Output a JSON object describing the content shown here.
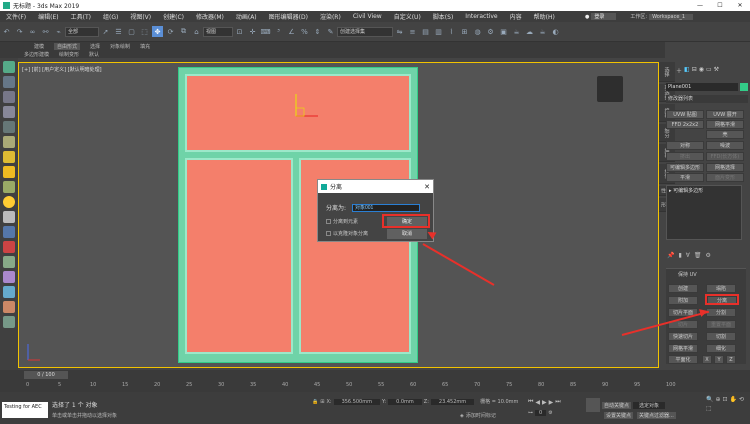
{
  "window": {
    "title": "无标题 - 3ds Max 2019",
    "user": "登录",
    "workspace_label": "工作区:",
    "workspace_value": "Workspace_1"
  },
  "menu": [
    "文件(F)",
    "编辑(E)",
    "工具(T)",
    "组(G)",
    "视图(V)",
    "创建(C)",
    "修改器(M)",
    "动画(A)",
    "图形编辑器(D)",
    "渲染(R)",
    "Civil View",
    "自定义(U)",
    "脚本(S)",
    "Interactive",
    "内容",
    "帮助(H)"
  ],
  "toolbar": {
    "filter": "全部",
    "view": "视图",
    "selection_set": "创建选择集"
  },
  "ribbon": {
    "tabs": [
      "建模",
      "自由形式",
      "选择",
      "对象绘制",
      "填充"
    ],
    "sub": [
      "多边形建模",
      "绘制变形",
      "默认"
    ]
  },
  "viewport": {
    "label": "[+] [前] [用户定义] [默认明暗处理]"
  },
  "dialog": {
    "title": "分离",
    "detach_as_label": "分离为:",
    "detach_as_value": "对象001",
    "option1": "分离到元素",
    "option2": "以克隆对象分离",
    "ok": "确定",
    "cancel": "取消"
  },
  "right_tabs": [
    "选择",
    "软选择",
    "编辑",
    "细分",
    "编辑",
    "绘制",
    "属性",
    "多边形"
  ],
  "panel": {
    "object_name": "Plane001",
    "modifier_list": "修改器列表",
    "buttons": [
      "UVW 贴图",
      "UVW 展开",
      "FFD 2x2x2",
      "网格平滑",
      "壳",
      "对称",
      "噪波",
      "挤出",
      "FFD(长方体)",
      "可编辑多边形",
      "网格选择",
      "平滑",
      "面片变形"
    ],
    "stack_item": "可编辑多边形",
    "section_title": "保持 UV",
    "edit_buttons": [
      "创建",
      "塌陷",
      "附加",
      "分离",
      "切片平面",
      "分割",
      "切片",
      "重置平面",
      "快速切片",
      "切割",
      "网格平滑",
      "细化",
      "平面化",
      "X",
      "Y",
      "Z"
    ]
  },
  "timeline": {
    "frame": "0 / 100",
    "ticks": [
      "0",
      "5",
      "10",
      "15",
      "20",
      "25",
      "30",
      "35",
      "40",
      "45",
      "50",
      "55",
      "60",
      "65",
      "70",
      "75",
      "80",
      "85",
      "90",
      "95",
      "100"
    ]
  },
  "status": {
    "maxscript": "Testing for AEC",
    "selected": "选择了 1 个 对象",
    "hint": "单击或单击并拖动以选择对象",
    "x_label": "X:",
    "x_value": "356.500mm",
    "y_label": "Y:",
    "y_value": "0.0mm",
    "z_label": "Z:",
    "z_value": "23.452mm",
    "grid": "栅格 = 10.0mm",
    "add_time_tag": "添加时间标记",
    "autokey": "自动关键点",
    "selected_object": "选定对象",
    "set_key": "设置关键点",
    "key_filters": "关键点过滤器...",
    "frame_value": "0"
  },
  "colors": {
    "accent": "#f2c300",
    "pane": "#f47f6b",
    "frame": "#6fd3a8",
    "highlight": "#e8302a"
  }
}
